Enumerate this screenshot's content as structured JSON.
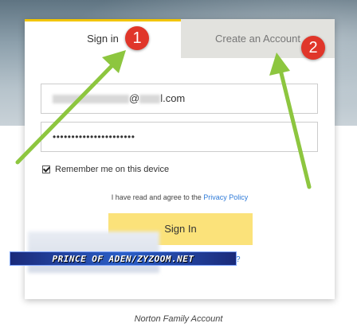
{
  "tabs": {
    "signin_label": "Sign in",
    "create_label": "Create an Account"
  },
  "form": {
    "email_visible_prefix": "@",
    "email_visible_suffix": "l.com",
    "password_mask": "••••••••••••••••••••••",
    "remember_label": "Remember me on this device",
    "remember_checked": true,
    "agree_text": "I have read and agree to the ",
    "privacy_link": "Privacy Policy",
    "signin_button": "Sign In",
    "partial_link_tail": "?"
  },
  "annotations": {
    "badge_1": "1",
    "badge_2": "2"
  },
  "watermark": {
    "text": "PRINCE OF ADEN/ZYZOOM.NET"
  },
  "caption": "Norton Family Account",
  "colors": {
    "tab_active_border": "#f2c500",
    "signin_button_bg": "#fbe27a",
    "link": "#2f7bd8",
    "badge": "#e0362a",
    "arrow": "#8dc63f",
    "inactive_tab_bg": "#e2e2de"
  }
}
